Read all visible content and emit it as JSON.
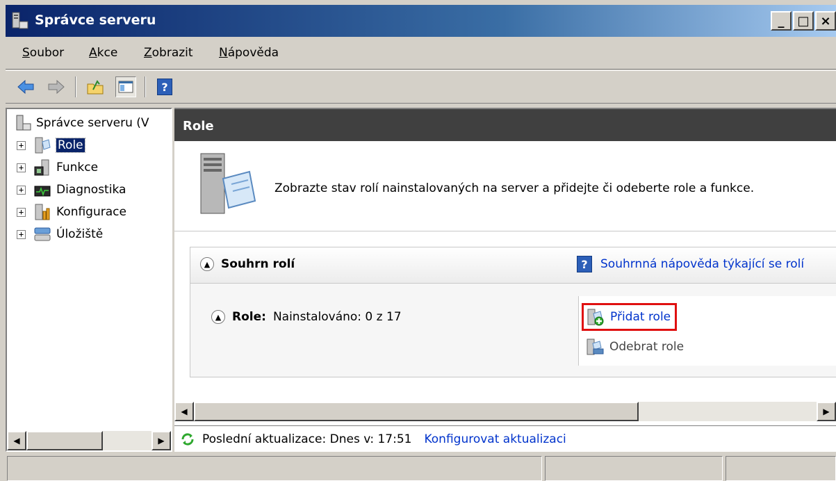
{
  "window": {
    "title": "Správce serveru",
    "minimize": "_",
    "maximize": "□",
    "close": "×",
    "brand_color": "#0a246a"
  },
  "menu": [
    {
      "pre": "",
      "u": "S",
      "post": "oubor"
    },
    {
      "pre": "",
      "u": "A",
      "post": "kce"
    },
    {
      "pre": "",
      "u": "Z",
      "post": "obrazit"
    },
    {
      "pre": "",
      "u": "N",
      "post": "ápověda"
    }
  ],
  "toolbar": {
    "icons": [
      "back-arrow-icon",
      "forward-arrow-icon",
      "up-folder-icon",
      "show-hide-tree-icon",
      "help-icon"
    ],
    "help_glyph": "?"
  },
  "tree": {
    "root": "Správce serveru (V",
    "nodes": [
      {
        "label": "Role",
        "selected": true,
        "icon": "roles-icon"
      },
      {
        "label": "Funkce",
        "icon": "features-icon"
      },
      {
        "label": "Diagnostika",
        "icon": "diagnostics-icon"
      },
      {
        "label": "Konfigurace",
        "icon": "configuration-icon"
      },
      {
        "label": "Úložiště",
        "icon": "storage-icon"
      }
    ],
    "expander": "+"
  },
  "content": {
    "header": "Role",
    "intro": "Zobrazte stav rolí nainstalovaných na server a přidejte či odeberte role a funkce.",
    "summary": {
      "title": "Souhrn rolí",
      "help_link": "Souhrnná nápověda týkající se rolí",
      "roles_label": "Role:",
      "roles_value": "Nainstalováno: 0 z 17",
      "add_roles": "Přidat role",
      "remove_roles": "Odebrat role",
      "highlight_color": "#e01010"
    },
    "status": {
      "last_update": "Poslední aktualizace: Dnes v: 17:51",
      "configure_link": "Konfigurovat aktualizaci"
    }
  }
}
